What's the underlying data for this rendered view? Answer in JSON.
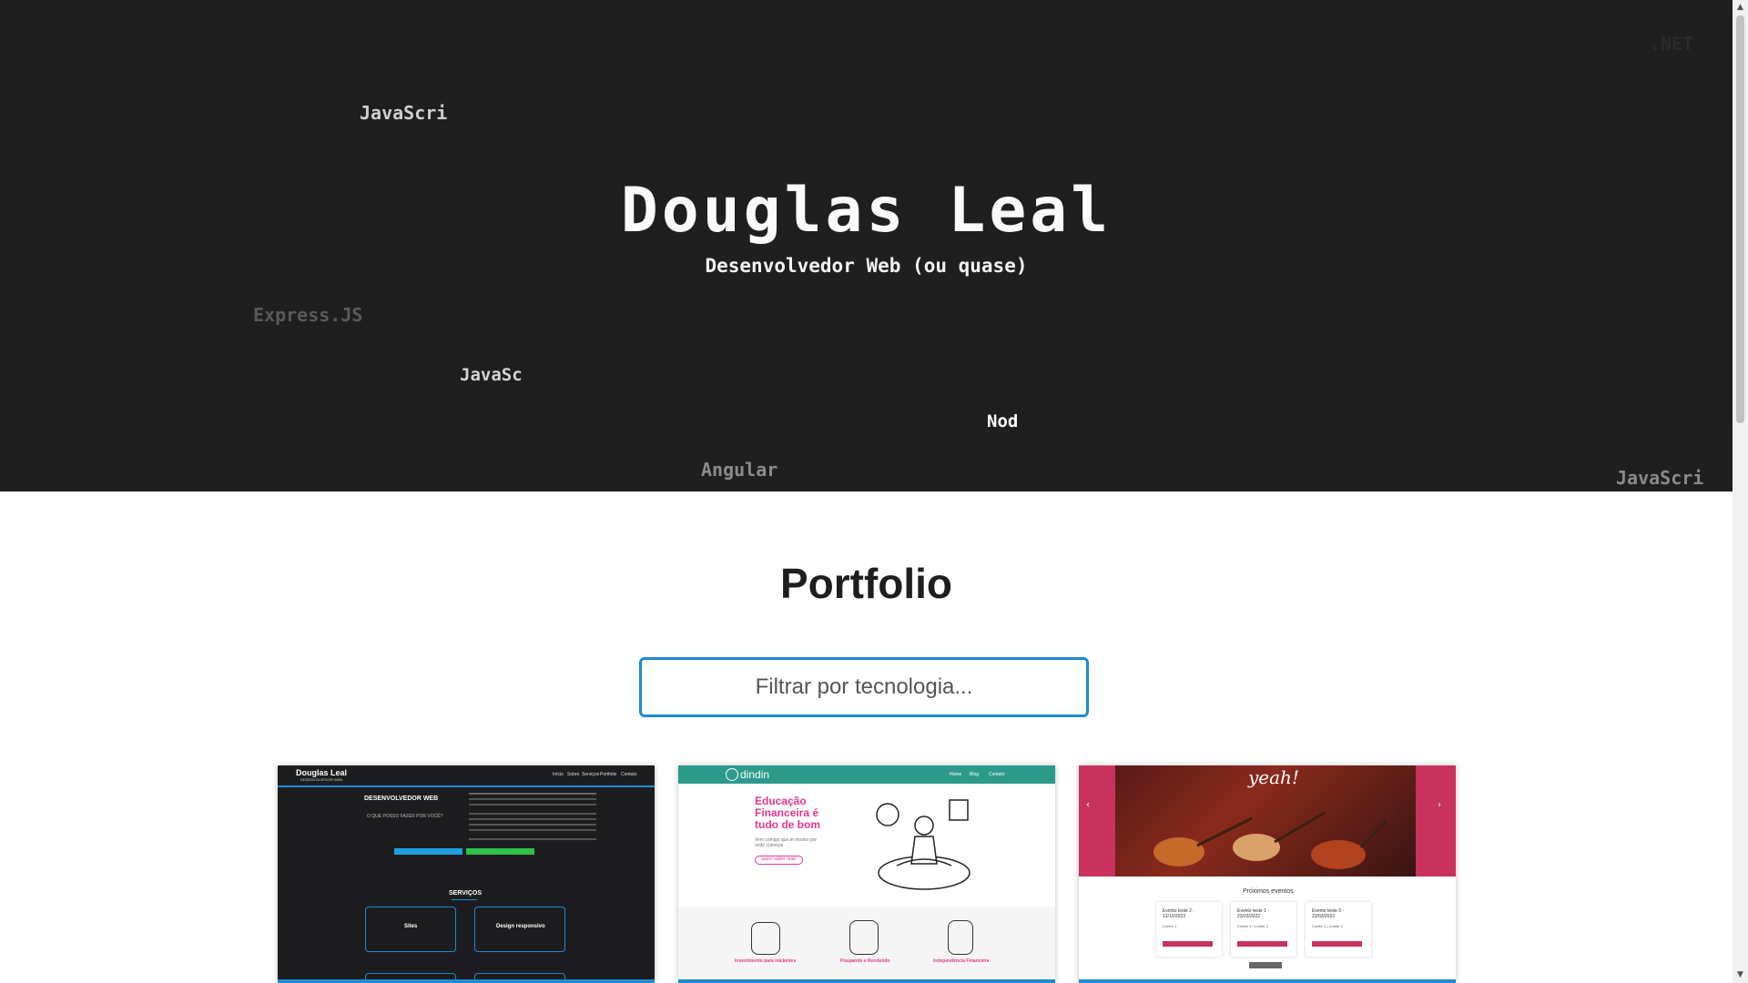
{
  "hero": {
    "title": "Douglas Leal",
    "subtitle": "Desenvolvedor Web (ou quase)",
    "floating_tech": [
      {
        "text": ".NET",
        "color": "#2b2b2b"
      },
      {
        "text": "JavaScri",
        "color": "#cfcfcf"
      },
      {
        "text": "Express.JS",
        "color": "#5a5a5a"
      },
      {
        "text": "JavaSc",
        "color": "#d4d4d4"
      },
      {
        "text": "Nod",
        "color": "#ffffff"
      },
      {
        "text": "Angular",
        "color": "#8c8c8c"
      },
      {
        "text": "JavaScri",
        "color": "#8a8a8a"
      }
    ]
  },
  "portfolio": {
    "title": "Portfolio",
    "filter_placeholder": "Filtrar por tecnologia..."
  },
  "projects": [
    {
      "site_title": "Douglas Leal",
      "site_tag": "DESENVOLVEDOR WEB",
      "nav": [
        "Início",
        "Sobre",
        "Serviços",
        "Portfolio",
        "Contato"
      ],
      "heading": "DESENVOLVEDOR WEB",
      "subheading": "O QUE POSSO FAZER POR VOCÊ?",
      "services_title": "SERVIÇOS",
      "service_1": "Sites",
      "service_2": "Design responsivo"
    },
    {
      "brand": "dindin",
      "nav": [
        "Home",
        "Blog",
        "Contato"
      ],
      "headline": "Educação Financeira é tudo de bom",
      "tagline": "Vem comigo que te mostro por onde começar",
      "cta": "quero saber mais",
      "features": [
        "Investimento para iniciantes",
        "Poupando e Rendendo",
        "Independência Financeira"
      ]
    },
    {
      "banner_text": "yeah!",
      "events_title": "Próximos eventos",
      "events": [
        {
          "name": "Evento teste 2 - 12/10/2023",
          "place": "Confor 1"
        },
        {
          "name": "Evento teste 1 - 23/03/2022",
          "place": "Confor 1 | Confor 2"
        },
        {
          "name": "Evento teste 3 - 23/03/2022",
          "place": "Confor 1 | Confor 2"
        }
      ]
    }
  ],
  "colors": {
    "hero_bg": "#1f1f1f",
    "accent": "#1f8bd1",
    "dindin_teal": "#2b9a8a",
    "dindin_pink": "#e8368f",
    "events_magenta": "#c8325c"
  }
}
